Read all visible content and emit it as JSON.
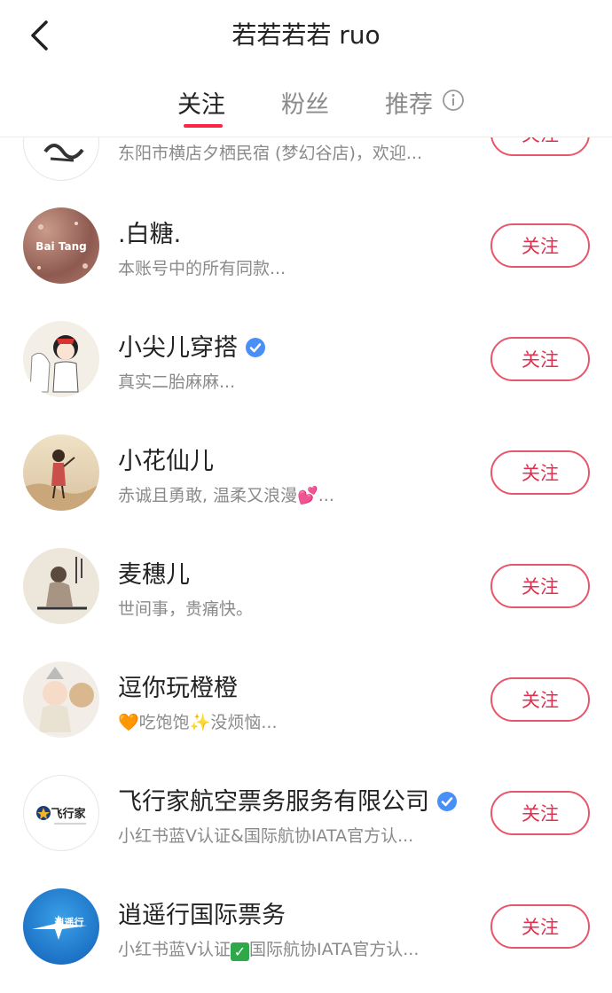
{
  "header": {
    "title": "若若若若 ruo",
    "tabs": [
      {
        "label": "关注"
      },
      {
        "label": "粉丝"
      },
      {
        "label": "推荐"
      }
    ]
  },
  "colors": {
    "accent": "#ff2442",
    "follow_border": "#e8566a",
    "verified_blue": "#4a8ff5",
    "muted_text": "#8a8a8a"
  },
  "follow_label": "关注",
  "users": [
    {
      "name": "",
      "desc": "东阳市横店夕栖民宿 (梦幻谷店)，欢迎...",
      "avatar_icon": "calligraphy-avatar"
    },
    {
      "name": ".白糖.",
      "desc": "本账号中的所有同款...",
      "avatar_text": "Bai Tang",
      "avatar_icon": "pink-glitter-avatar"
    },
    {
      "name": "小尖儿穿搭",
      "desc": "真实二胎麻麻...",
      "verified": true,
      "avatar_icon": "cartoon-girl-avatar"
    },
    {
      "name": "小花仙儿",
      "desc_prefix": "赤诚且勇敢, 温柔又浪漫",
      "desc_suffix": "...",
      "emoji": "💕",
      "avatar_icon": "painted-girl-avatar"
    },
    {
      "name": "麦穗儿",
      "desc": "世间事，贵痛快。",
      "avatar_icon": "ink-sketch-avatar"
    },
    {
      "name": "逗你玩橙橙",
      "desc_emoji1": "🧡",
      "desc_mid1": "吃饱饱",
      "desc_emoji2": "✨",
      "desc_mid2": "没烦恼...",
      "avatar_icon": "baby-avatar"
    },
    {
      "name": "飞行家航空票务服务有限公司",
      "desc": "小红书蓝V认证&国际航协IATA官方认...",
      "verified": true,
      "avatar_text": "飞行家",
      "avatar_icon": "airline-logo-avatar"
    },
    {
      "name": "逍遥行国际票务",
      "desc_prefix": "小红书蓝V认证",
      "desc_suffix": "国际航协IATA官方认...",
      "avatar_text": "逍遥行",
      "avatar_icon": "plane-logo-avatar"
    }
  ]
}
